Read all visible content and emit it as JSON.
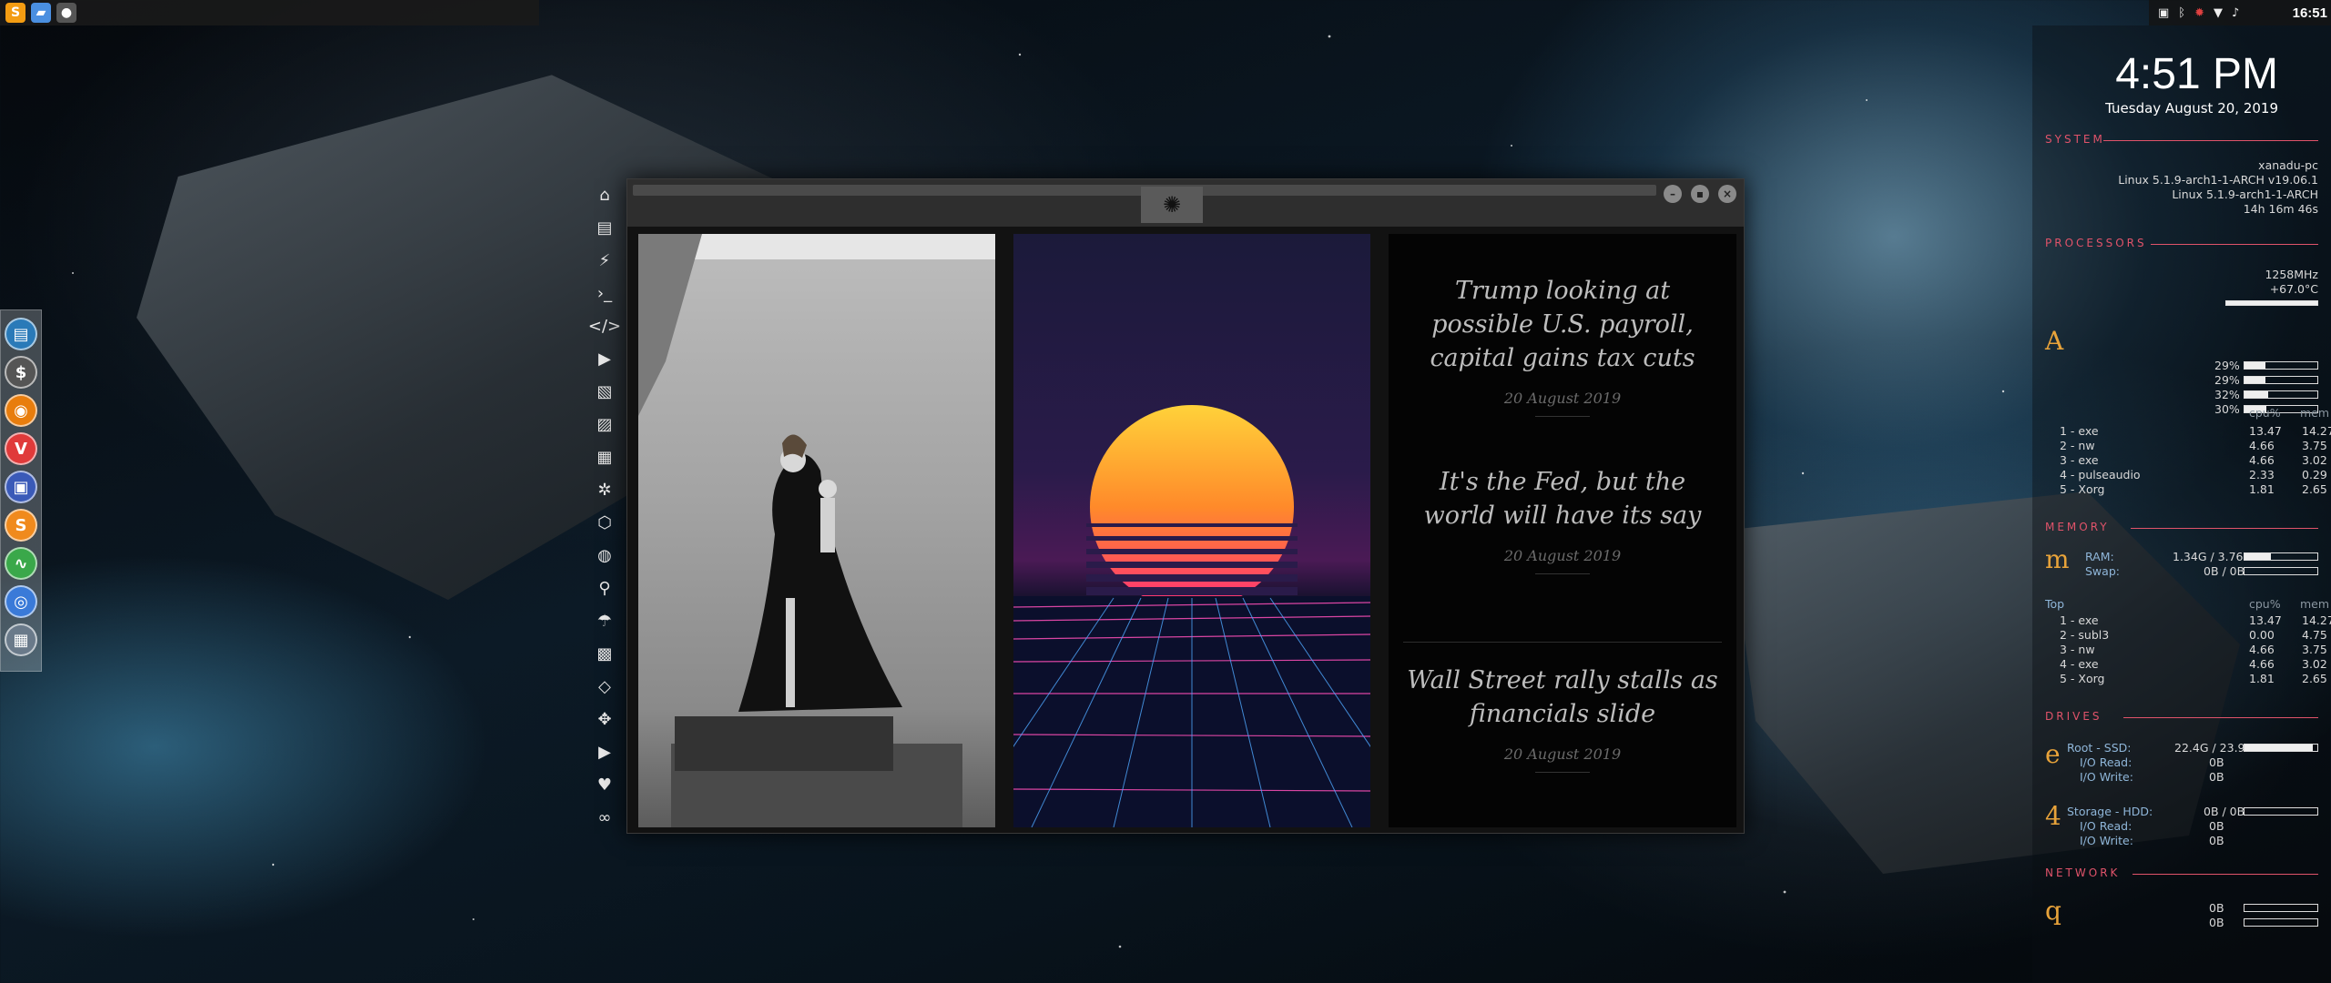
{
  "topbar": {
    "apps": [
      {
        "icon": "sublime-icon",
        "glyph": "S",
        "color": "#f39c12"
      },
      {
        "icon": "folder-icon",
        "glyph": "▰",
        "color": "#4a8fe0"
      },
      {
        "icon": "workspace-icon",
        "glyph": "●",
        "color": "#555"
      }
    ],
    "time": "16:51"
  },
  "dock": [
    {
      "icon": "file-manager-icon",
      "glyph": "▤",
      "color": "#2a7ab8"
    },
    {
      "icon": "terminal-icon",
      "glyph": "$",
      "color": "#555"
    },
    {
      "icon": "blender-icon",
      "glyph": "◉",
      "color": "#e87d0d"
    },
    {
      "icon": "vivaldi-icon",
      "glyph": "V",
      "color": "#e03a3a"
    },
    {
      "icon": "screen-icon",
      "glyph": "▣",
      "color": "#3a5ab8"
    },
    {
      "icon": "sublime-icon",
      "glyph": "S",
      "color": "#f08a1d"
    },
    {
      "icon": "system-monitor-icon",
      "glyph": "∿",
      "color": "#3aa84a"
    },
    {
      "icon": "chrome-icon",
      "glyph": "◎",
      "color": "#3a7ad8"
    },
    {
      "icon": "network-icon",
      "glyph": "▦",
      "color": "#6a7a8a"
    }
  ],
  "sidenav": [
    "home-icon",
    "document-icon",
    "bolt-icon",
    "terminal-icon",
    "code-icon",
    "play-icon",
    "images-icon",
    "image-icon",
    "news-icon",
    "settings-icon",
    "gem-icon",
    "globe-icon",
    "search-icon",
    "umbrella-icon",
    "contact-icon",
    "code-brackets-icon",
    "expand-icon",
    "youtube-icon",
    "heart-icon",
    "infinity-icon"
  ],
  "news": [
    {
      "title": "Trump looking at possible U.S. payroll, capital gains tax cuts",
      "date": "20 August 2019"
    },
    {
      "title": "It's the Fed, but the world will have its say",
      "date": "20 August 2019"
    },
    {
      "title": "Wall Street rally stalls as financials slide",
      "date": "20 August 2019"
    }
  ],
  "conky": {
    "clock": "4:51 PM",
    "date": "Tuesday August 20, 2019",
    "system": {
      "heading": "SYSTEM",
      "hostname": "xanadu-pc",
      "kernel1": "Linux 5.1.9-arch1-1-ARCH v19.06.1",
      "kernel2": "Linux 5.1.9-arch1-1-ARCH",
      "uptime": "14h 16m 46s"
    },
    "processors": {
      "heading": "PROCESSORS",
      "freq": "1258MHz",
      "temp": "+67.0°C",
      "glyph": "A",
      "cores": [
        {
          "label": "29%",
          "fill": 0.29
        },
        {
          "label": "29%",
          "fill": 0.29
        },
        {
          "label": "32%",
          "fill": 0.32
        },
        {
          "label": "30%",
          "fill": 0.3
        }
      ],
      "col_cpu": "cpu%",
      "col_mem": "mem",
      "top": [
        {
          "name": "1 - exe",
          "cpu": "13.47",
          "mem": "14.27"
        },
        {
          "name": "2 - nw",
          "cpu": "4.66",
          "mem": "3.75"
        },
        {
          "name": "3 - exe",
          "cpu": "4.66",
          "mem": "3.02"
        },
        {
          "name": "4 - pulseaudio",
          "cpu": "2.33",
          "mem": "0.29"
        },
        {
          "name": "5 - Xorg",
          "cpu": "1.81",
          "mem": "2.65"
        }
      ]
    },
    "memory": {
      "heading": "MEMORY",
      "glyph": "m",
      "ram_label": "RAM:",
      "ram": "1.34G / 3.76G",
      "ram_fill": 0.36,
      "swap_label": "Swap:",
      "swap": "0B / 0B",
      "swap_fill": 0,
      "top_label": "Top",
      "col_cpu": "cpu%",
      "col_mem": "mem",
      "top": [
        {
          "name": "1 - exe",
          "cpu": "13.47",
          "mem": "14.27"
        },
        {
          "name": "2 - subl3",
          "cpu": "0.00",
          "mem": "4.75"
        },
        {
          "name": "3 - nw",
          "cpu": "4.66",
          "mem": "3.75"
        },
        {
          "name": "4 - exe",
          "cpu": "4.66",
          "mem": "3.02"
        },
        {
          "name": "5 - Xorg",
          "cpu": "1.81",
          "mem": "2.65"
        }
      ]
    },
    "drives": {
      "heading": "DRIVES",
      "root": {
        "glyph": "e",
        "label": "Root - SSD:",
        "value": "22.4G / 23.9G",
        "fill": 0.94,
        "read_label": "I/O Read:",
        "read": "0B",
        "write_label": "I/O Write:",
        "write": "0B"
      },
      "storage": {
        "glyph": "4",
        "label": "Storage - HDD:",
        "value": "0B / 0B",
        "fill": 0,
        "read_label": "I/O Read:",
        "read": "0B",
        "write_label": "I/O Write:",
        "write": "0B"
      }
    },
    "network": {
      "heading": "NETWORK",
      "glyph": "q",
      "down": "0B",
      "up": "0B"
    }
  }
}
